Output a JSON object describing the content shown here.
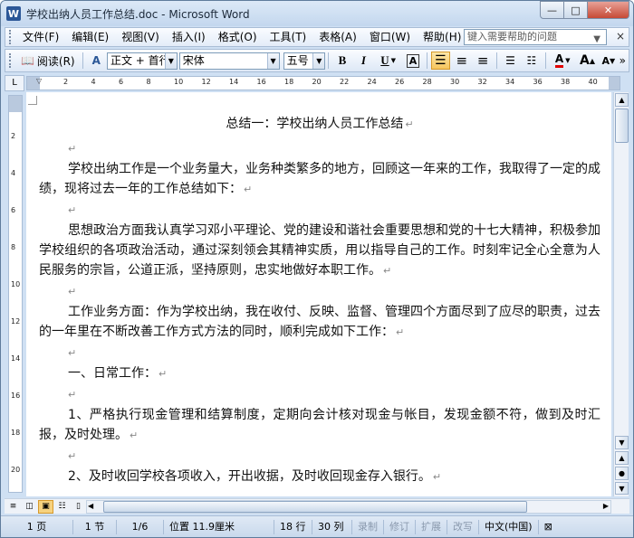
{
  "window": {
    "title": "学校出纳人员工作总结.doc - Microsoft Word",
    "app_icon_letter": "W",
    "controls": {
      "minimize": "—",
      "maximize": "□",
      "close": "✕"
    }
  },
  "menubar": {
    "items": [
      "文件(F)",
      "编辑(E)",
      "视图(V)",
      "插入(I)",
      "格式(O)",
      "工具(T)",
      "表格(A)",
      "窗口(W)",
      "帮助(H)"
    ],
    "help_placeholder": "键入需要帮助的问题",
    "close_glyph": "×"
  },
  "toolbar": {
    "read_label": "阅读(R)",
    "style_value": "正文 + 首行",
    "font_value": "宋体",
    "size_value": "五号",
    "bold": "B",
    "italic": "I",
    "underline": "U",
    "char_border": "A",
    "align_left": "≡",
    "align_center": "≡",
    "align_right": "≡",
    "numbering": "☰",
    "bullets": "☷",
    "font_color": "A",
    "grow_font": "A",
    "shrink_font": "A",
    "overflow": "»"
  },
  "ruler": {
    "corner": "L",
    "numbers": [
      "2",
      "4",
      "6",
      "8",
      "10",
      "12",
      "14",
      "16",
      "18",
      "20",
      "22",
      "24",
      "26",
      "28",
      "30",
      "32",
      "34",
      "36",
      "38",
      "40"
    ],
    "vertical_numbers": [
      "2",
      "4",
      "6",
      "8",
      "10",
      "12",
      "14",
      "16",
      "18",
      "20"
    ]
  },
  "document": {
    "title": "总结一：学校出纳人员工作总结",
    "paragraph_mark": "↵",
    "paragraphs": [
      "学校出纳工作是一个业务量大，业务种类繁多的地方，回顾这一年来的工作，我取得了一定的成绩，现将过去一年的工作总结如下：",
      "思想政治方面我认真学习邓小平理论、党的建设和谐社会重要思想和党的十七大精神，积极参加学校组织的各项政治活动，通过深刻领会其精神实质，用以指导自己的工作。时刻牢记全心全意为人民服务的宗旨，公道正派，坚持原则，忠实地做好本职工作。",
      "工作业务方面：作为学校出纳，我在收付、反映、监督、管理四个方面尽到了应尽的职责，过去的一年里在不断改善工作方式方法的同时，顺利完成如下工作：",
      "一、日常工作：",
      "1、严格执行现金管理和结算制度，定期向会计核对现金与帐目，发现金额不符，做到及时汇报，及时处理。",
      "2、及时收回学校各项收入，开出收据，及时收回现金存入银行。"
    ]
  },
  "status": {
    "page": "1 页",
    "section": "1 节",
    "page_of": "1/6",
    "position": "位置 11.9厘米",
    "line": "18 行",
    "column": "30 列",
    "rec": "录制",
    "trk": "修订",
    "ext": "扩展",
    "ovr": "改写",
    "language": "中文(中国)"
  }
}
